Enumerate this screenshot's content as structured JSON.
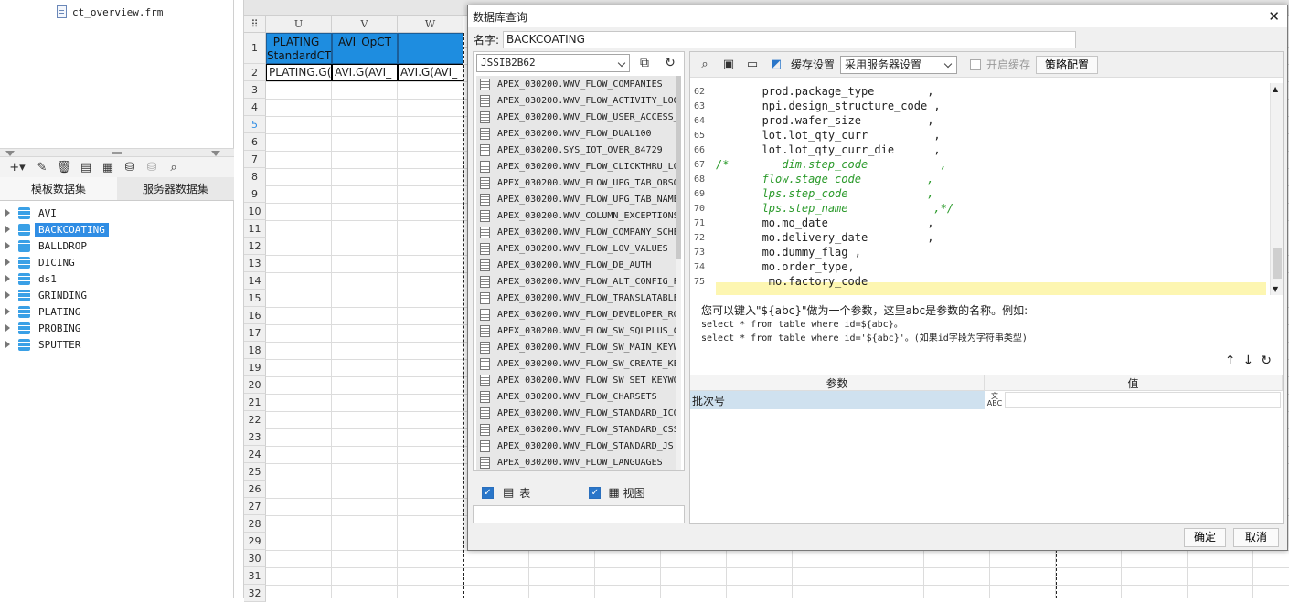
{
  "left_panel": {
    "file_name": "ct_overview.frm",
    "tabs": [
      "模板数据集",
      "服务器数据集"
    ],
    "datasets": [
      "AVI",
      "BACKCOATING",
      "BALLDROP",
      "DICING",
      "ds1",
      "GRINDING",
      "PLATING",
      "PROBING",
      "SPUTTER"
    ],
    "selected": "BACKCOATING"
  },
  "sheet": {
    "corner": "⠿",
    "columns": [
      "U",
      "V",
      "W"
    ],
    "rows": [
      "1",
      "2",
      "3",
      "4",
      "5",
      "6",
      "7",
      "8",
      "9",
      "10",
      "11",
      "12",
      "13",
      "14",
      "15",
      "16",
      "17",
      "18",
      "19",
      "20",
      "21",
      "22",
      "23",
      "24",
      "25",
      "26",
      "27",
      "28",
      "29",
      "30",
      "31",
      "32"
    ],
    "header_cells": [
      "PLATING_ StandardCT",
      "AVI_OpCT",
      ""
    ],
    "value_cells": [
      "PLATING.G(",
      "AVI.G(AVI_",
      "AVI.G(AVI_"
    ]
  },
  "dialog": {
    "title": "数据库查询",
    "name_label": "名字:",
    "name_value": "BACKCOATING",
    "datasource": "JSSIB2B62",
    "tables": [
      "APEX_030200.WWV_FLOW_COMPANIES",
      "APEX_030200.WWV_FLOW_ACTIVITY_LOG",
      "APEX_030200.WWV_FLOW_USER_ACCESS_",
      "APEX_030200.WWV_FLOW_DUAL100",
      "APEX_030200.SYS_IOT_OVER_84729",
      "APEX_030200.WWV_FLOW_CLICKTHRU_LO",
      "APEX_030200.WWV_FLOW_UPG_TAB_OBSO",
      "APEX_030200.WWV_FLOW_UPG_TAB_NAME",
      "APEX_030200.WWV_COLUMN_EXCEPTIONS",
      "APEX_030200.WWV_FLOW_COMPANY_SCHE",
      "APEX_030200.WWV_FLOW_LOV_VALUES",
      "APEX_030200.WWV_FLOW_DB_AUTH",
      "APEX_030200.WWV_FLOW_ALT_CONFIG_P",
      "APEX_030200.WWV_FLOW_TRANSLATABLE",
      "APEX_030200.WWV_FLOW_DEVELOPER_RO",
      "APEX_030200.WWV_FLOW_SW_SQLPLUS_C",
      "APEX_030200.WWV_FLOW_SW_MAIN_KEYW",
      "APEX_030200.WWV_FLOW_SW_CREATE_KE",
      "APEX_030200.WWV_FLOW_SW_SET_KEYWO",
      "APEX_030200.WWV_FLOW_CHARSETS",
      "APEX_030200.WWV_FLOW_STANDARD_ICO",
      "APEX_030200.WWV_FLOW_STANDARD_CSS",
      "APEX_030200.WWV_FLOW_STANDARD_JS",
      "APEX_030200.WWV_FLOW_LANGUAGES"
    ],
    "filter_table": "表",
    "filter_view": "视图",
    "cache_label": "缓存设置",
    "cache_value": "采用服务器设置",
    "enable_cache": "开启缓存",
    "strategy": "策略配置",
    "code_lines": [
      {
        "n": "62",
        "t": "       prod.package_type        ,",
        "c": false
      },
      {
        "n": "63",
        "t": "       npi.design_structure_code ,",
        "c": false
      },
      {
        "n": "64",
        "t": "       prod.wafer_size          ,",
        "c": false
      },
      {
        "n": "65",
        "t": "       lot.lot_qty_curr          ,",
        "c": false
      },
      {
        "n": "66",
        "t": "       lot.lot_qty_curr_die      ,",
        "c": false
      },
      {
        "n": "67",
        "t": "/*        dim.step_code           ,",
        "c": true
      },
      {
        "n": "68",
        "t": "       flow.stage_code          ,",
        "c": true
      },
      {
        "n": "69",
        "t": "       lps.step_code            ,",
        "c": true
      },
      {
        "n": "70",
        "t": "       lps.step_name             ,*/",
        "c": true
      },
      {
        "n": "71",
        "t": "       mo.mo_date               ,",
        "c": false
      },
      {
        "n": "72",
        "t": "       mo.delivery_date         ,",
        "c": false
      },
      {
        "n": "73",
        "t": "       mo.dummy_flag ,",
        "c": false
      },
      {
        "n": "74",
        "t": "       mo.order_type,",
        "c": false
      },
      {
        "n": "75",
        "t": "        mo.factory_code",
        "c": false
      }
    ],
    "hint_line1": "您可以键入\"${abc}\"做为一个参数，这里abc是参数的名称。例如:",
    "hint_line2": "select * from table where id=${abc}。",
    "hint_line3": "select * from table where id='${abc}'。(如果id字段为字符串类型)",
    "param_header": "参数",
    "value_header": "值",
    "params": [
      {
        "name": "批次号",
        "type": "文\nABC",
        "value": ""
      }
    ],
    "ok": "确定",
    "cancel": "取消"
  }
}
